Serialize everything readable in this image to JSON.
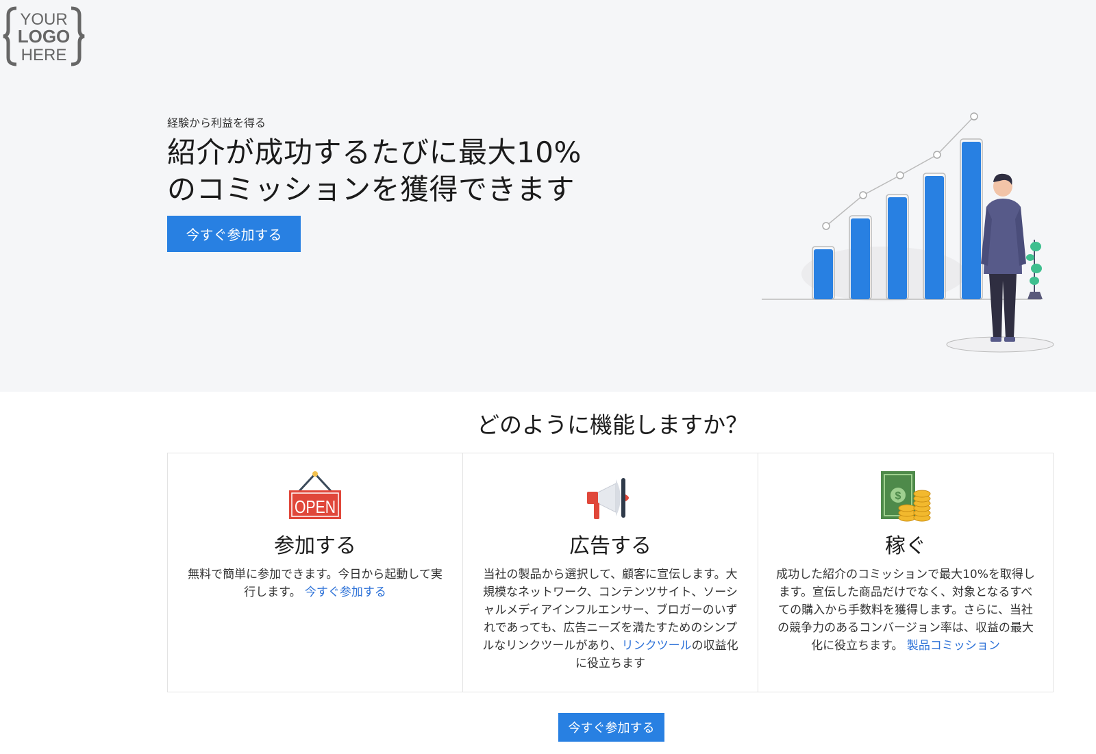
{
  "logo": {
    "line1": "YOUR",
    "line2": "LOGO",
    "line3": "HERE"
  },
  "hero": {
    "eyebrow": "経験から利益を得る",
    "headline_line1": "紹介が成功するたびに最大10%",
    "headline_line2": "のコミッションを獲得できます",
    "cta_label": "今すぐ参加する",
    "illustration_icon": "growth-chart-businessman-illustration"
  },
  "how": {
    "title": "どのように機能しますか？",
    "cards": [
      {
        "icon": "open-sign-icon",
        "icon_text": "OPEN",
        "title": "参加する",
        "desc": "無料で簡単に参加できます。今日から起動して実行します。",
        "link": "今すぐ参加する",
        "after_link": ""
      },
      {
        "icon": "megaphone-icon",
        "title": "広告する",
        "desc": "当社の製品から選択して、顧客に宣伝します。大規模なネットワーク、コンテンツサイト、ソーシャルメディアインフルエンサー、ブロガーのいずれであっても、広告ニーズを満たすためのシンプルなリンクツールがあり、",
        "link": "リンクツール",
        "after_link": "の収益化に役立ちます"
      },
      {
        "icon": "money-coins-icon",
        "title": "稼ぐ",
        "desc": "成功した紹介のコミッションで最大10%を取得します。宣伝した商品だけでなく、対象となるすべての購入から手数料を獲得します。さらに、当社の競争力のあるコンバージョン率は、収益の最大化に役立ちます。",
        "link": "製品コミッション",
        "after_link": ""
      }
    ]
  },
  "bottom_cta_label": "今すぐ参加する",
  "colors": {
    "accent": "#2880e2",
    "hero_bg": "#f5f6f8",
    "link": "#2f73d8"
  }
}
